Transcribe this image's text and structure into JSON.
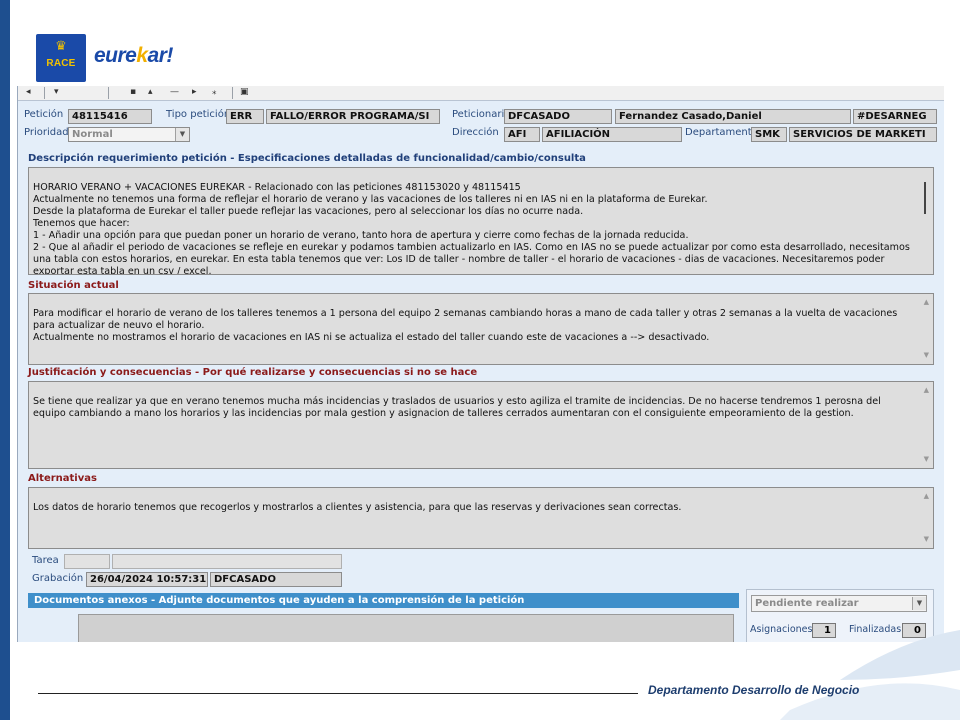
{
  "brand": {
    "logo_text": "RACE",
    "name_prefix": "eure",
    "name_accent": "k",
    "name_suffix": "ar!"
  },
  "toolbar": {
    "icons": [
      "back-icon",
      "save-icon",
      "print-icon",
      "attach-icon",
      "refresh-icon",
      "cut-icon",
      "copy-icon",
      "help-icon"
    ]
  },
  "form": {
    "peticion_label": "Petición",
    "peticion_value": "48115416",
    "tipo_label": "Tipo petición",
    "tipo_code": "ERR",
    "tipo_desc": "FALLO/ERROR PROGRAMA/SI",
    "peticionario_label": "Peticionario",
    "peticionario_code": "DFCASADO",
    "peticionario_name": "Fernandez Casado,Daniel",
    "peticionario_group": "#DESARNEG",
    "prioridad_label": "Prioridad",
    "prioridad_value": "Normal",
    "direccion_label": "Dirección",
    "direccion_code": "AFI",
    "direccion_desc": "AFILIACIÓN",
    "departamento_label": "Departamento",
    "departamento_code": "SMK",
    "departamento_desc": "SERVICIOS DE MARKETI"
  },
  "descripcion": {
    "title": "Descripción requerimiento petición -  Especificaciones detalladas de funcionalidad/cambio/consulta",
    "text": "HORARIO VERANO + VACACIONES EUREKAR - Relacionado con las peticiones 481153020 y 48115415\nActualmente no tenemos una forma de reflejar el horario de verano y las vacaciones de los talleres ni en IAS ni en la plataforma de Eurekar.\nDesde la plataforma de Eurekar el taller puede reflejar las vacaciones, pero al seleccionar los días no ocurre nada.\nTenemos que hacer:\n1 - Añadir una opción para que puedan poner un horario de verano, tanto hora de apertura y cierre como fechas de la jornada reducida.\n2 - Que al añadir el periodo de vacaciones se refleje en eurekar y podamos tambien actualizarlo en IAS. Como en IAS no se puede actualizar por como esta desarrollado, necesitamos una tabla con estos horarios, en eurekar. En esta tabla tenemos que ver: Los ID de taller - nombre de taller - el horario de vacaciones - dias de vacaciones. Necesitaremos poder exportar esta tabla en un csv / excel."
  },
  "situacion": {
    "title": "Situación actual",
    "text": "Para modificar el horario de verano de los talleres tenemos a 1 persona del equipo 2 semanas cambiando horas a mano de cada taller y otras 2 semanas a la vuelta de vacaciones para actualizar de neuvo el horario.\nActualmente no mostramos el horario de vacaciones en IAS ni se actualiza el estado del taller cuando este de vacaciones a --> desactivado."
  },
  "justificacion": {
    "title": "Justificación y consecuencias -  Por qué realizarse y consecuencias si no se hace",
    "text": "Se tiene que realizar ya que en verano tenemos mucha más incidencias y traslados de usuarios y esto agiliza el tramite de incidencias. De no hacerse tendremos 1 perosna del equipo cambiando a mano los horarios y las incidencias por mala gestion y asignacion de talleres cerrados aumentaran con el consiguiente empeoramiento de la gestion."
  },
  "alternativas": {
    "title": "Alternativas",
    "text": "Los datos de horario tenemos que recogerlos y mostrarlos a clientes y asistencia, para que las reservas y derivaciones sean correctas."
  },
  "tarea": {
    "label": "Tarea",
    "code": "",
    "desc": ""
  },
  "grabacion": {
    "label": "Grabación",
    "datetime": "26/04/2024 10:57:31",
    "user": "DFCASADO"
  },
  "documentos": {
    "title": "Documentos anexos - Adjunte documentos que ayuden a  la comprensión de la petición"
  },
  "estado": {
    "status": "Pendiente realizar",
    "asignaciones_label": "Asignaciones",
    "asignaciones_value": "1",
    "finalizadas_label": "Finalizadas",
    "finalizadas_value": "0"
  },
  "footer": {
    "text": "Departamento Desarrollo de Negocio"
  },
  "colors": {
    "brand_blue": "#1a4aa8",
    "brand_yellow": "#f2c200",
    "section_blue": "#21407a",
    "section_red": "#8b1a1a",
    "docs_header": "#3f8fca"
  }
}
